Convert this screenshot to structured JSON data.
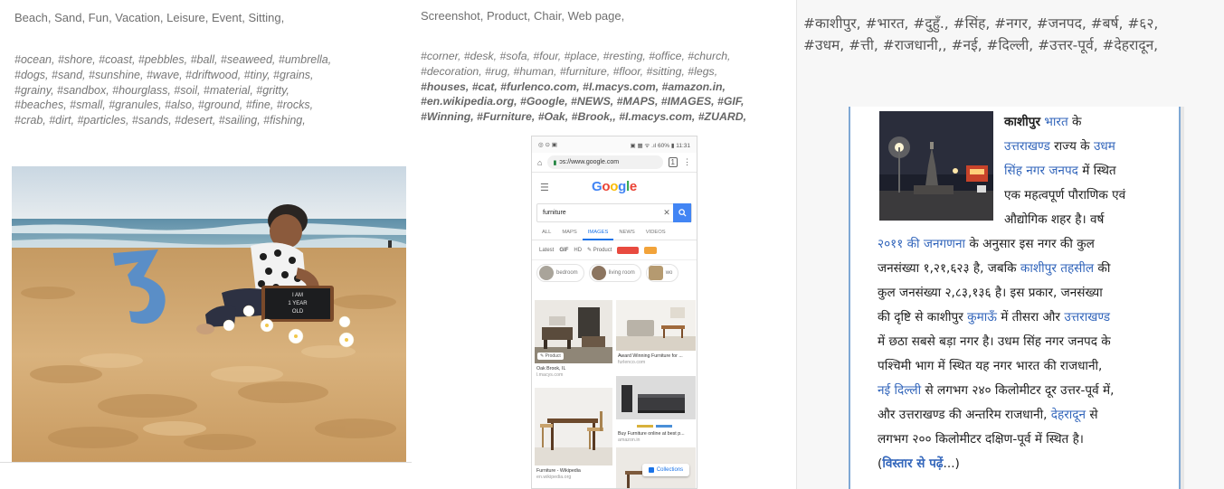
{
  "panel1": {
    "categories": "Beach, Sand, Fun, Vacation, Leisure, Event, Sitting,",
    "tag_lines": [
      "#ocean, #shore, #coast, #pebbles, #ball, #seaweed, #umbrella,",
      "#dogs, #sand, #sunshine, #wave, #driftwood, #tiny, #grains,",
      "#grainy, #sandbox, #hourglass, #soil, #material, #gritty,",
      "#beaches, #small, #granules, #also, #ground, #fine, #rocks,",
      "#crab, #dirt, #particles, #sands, #desert, #sailing, #fishing,"
    ],
    "chalkboard_lines": [
      "I AM",
      "1 YEAR",
      "OLD"
    ],
    "big_number": "3"
  },
  "panel2": {
    "categories": "Screenshot, Product, Chair, Web page,",
    "tag_lines": [
      "#corner, #desk, #sofa, #four, #place, #resting, #office, #church,",
      "#decoration, #rug, #human, #furniture, #floor, #sitting, #legs,",
      "#houses, #cat, #furlenco.com, #I.macys.com, #amazon.in,",
      "#en.wikipedia.org, #Google, #NEWS, #MAPS, #IMAGES, #GIF,",
      "#Winning, #Furniture, #Oak, #Brook,, #I.macys.com, #ZUARD,"
    ],
    "phone": {
      "status_left": "◎ ⊙ ▣",
      "status_right": "▣ ▦ ᯤ .ıl 60% ▮ 11:31",
      "url": "ɔs://www.google.com",
      "logo": [
        {
          "ch": "G",
          "color": "#4285f4"
        },
        {
          "ch": "o",
          "color": "#ea4335"
        },
        {
          "ch": "o",
          "color": "#fbbc05"
        },
        {
          "ch": "g",
          "color": "#4285f4"
        },
        {
          "ch": "l",
          "color": "#34a853"
        },
        {
          "ch": "e",
          "color": "#ea4335"
        }
      ],
      "search_value": "furniture",
      "tabs": [
        "ALL",
        "MAPS",
        "IMAGES",
        "NEWS",
        "VIDEOS"
      ],
      "active_tab": "IMAGES",
      "filters": [
        "Latest",
        "GIF",
        "HD",
        "✎ Product"
      ],
      "related": [
        "bedroom",
        "living room",
        "wo"
      ],
      "results": [
        {
          "caption": "Oak Brook, IL",
          "source": "l.macys.com",
          "badge": "✎ Product"
        },
        {
          "caption": "Award Winning Furniture for ...",
          "source": "furlenco.com",
          "badge": ""
        },
        {
          "caption": "Furniture - Wikipedia",
          "source": "en.wikipedia.org",
          "badge": ""
        },
        {
          "caption": "Buy Furniture online at best p...",
          "source": "amazon.in",
          "badge": ""
        }
      ],
      "collections": "Collections"
    }
  },
  "panel3": {
    "tag_lines": [
      "#काशीपुर, #भारत, #दुहुँ., #सिंह, #नगर, #जनपद, #बर्ष, #६२,",
      "#उधम, #त्ती, #राजधानी,, #नई, #दिल्ली, #उत्तर-पूर्व, #देहरादून,"
    ],
    "article_lines": [
      [
        {
          "t": "काशीपुर",
          "s": "bold"
        },
        {
          "t": " "
        },
        {
          "t": "भारत",
          "s": "link"
        },
        {
          "t": " के"
        }
      ],
      [
        {
          "t": "उत्तराखण्ड",
          "s": "link"
        },
        {
          "t": " राज्य के "
        },
        {
          "t": "उधम",
          "s": "link"
        }
      ],
      [
        {
          "t": "सिंह नगर जनपद",
          "s": "link"
        },
        {
          "t": " में स्थित"
        }
      ],
      [
        {
          "t": "एक महत्वपूर्ण पौराणिक एवं"
        }
      ],
      [
        {
          "t": "औद्योगिक शहर है। वर्ष"
        }
      ],
      [
        {
          "t": "२०११ की जनगणना",
          "s": "link"
        },
        {
          "t": " के अनुसार इस नगर की कुल"
        }
      ],
      [
        {
          "t": "जनसंख्या १,२१,६२३ है, जबकि "
        },
        {
          "t": "काशीपुर तहसील",
          "s": "link"
        },
        {
          "t": " की"
        }
      ],
      [
        {
          "t": "कुल जनसंख्या २,८३,१३६ है। इस प्रकार, जनसंख्या"
        }
      ],
      [
        {
          "t": "की दृष्टि से काशीपुर "
        },
        {
          "t": "कुमाऊँ",
          "s": "link"
        },
        {
          "t": " में तीसरा और "
        },
        {
          "t": "उत्तराखण्ड",
          "s": "link"
        }
      ],
      [
        {
          "t": "में छठा सबसे बड़ा नगर है। उधम सिंह नगर जनपद के"
        }
      ],
      [
        {
          "t": "पश्चिमी भाग में स्थित यह नगर भारत की राजधानी,"
        }
      ],
      [
        {
          "t": "नई दिल्ली",
          "s": "link"
        },
        {
          "t": " से लगभग २४० किलोमीटर दूर उत्तर-पूर्व में,"
        }
      ],
      [
        {
          "t": "और उत्तराखण्ड की अन्तरिम राजधानी, "
        },
        {
          "t": "देहरादून",
          "s": "link"
        },
        {
          "t": " से"
        }
      ],
      [
        {
          "t": "लगभग २०० किलोमीटर दक्षिण-पूर्व में स्थित है।"
        }
      ],
      [
        {
          "t": "("
        },
        {
          "t": "विस्तार से पढ़ें",
          "s": "boldlink"
        },
        {
          "t": "...)"
        }
      ]
    ]
  }
}
